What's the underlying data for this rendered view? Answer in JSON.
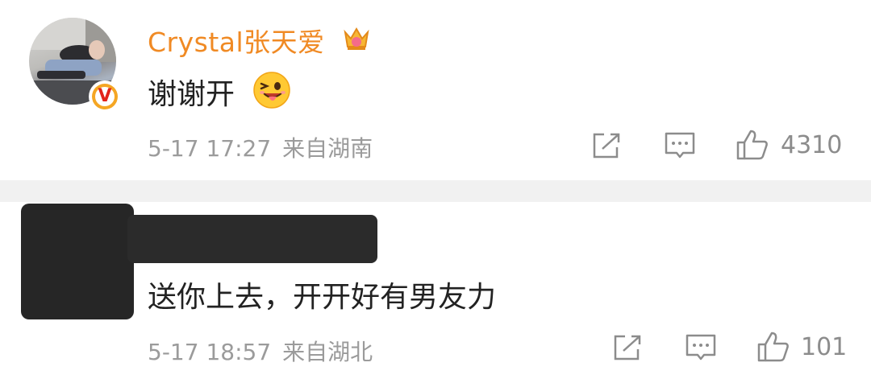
{
  "comments": [
    {
      "username": "Crystal张天爱",
      "verified_badge": "V",
      "text": "谢谢开",
      "time": "5-17 17:27",
      "location": "来自湖南",
      "likes": "4310",
      "icons": [
        "share-icon",
        "comment-icon",
        "like-icon",
        "crown-icon",
        "wink-emoji-icon"
      ]
    },
    {
      "username_redacted": true,
      "text": "送你上去，开开好有男友力",
      "time": "5-17 18:57",
      "location": "来自湖北",
      "likes": "101",
      "icons": [
        "share-icon",
        "comment-icon",
        "like-icon"
      ]
    }
  ],
  "colors": {
    "username": "#f08a24",
    "meta": "#9b9b9b",
    "divider": "#f1f1f1",
    "redaction": "#262626"
  }
}
